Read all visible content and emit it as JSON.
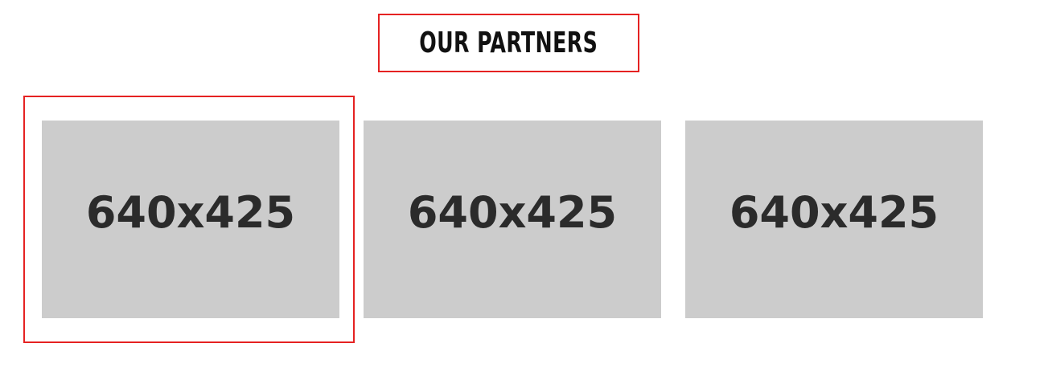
{
  "section": {
    "title": "OUR PARTNERS"
  },
  "partners": [
    {
      "placeholder_text": "640x425"
    },
    {
      "placeholder_text": "640x425"
    },
    {
      "placeholder_text": "640x425"
    }
  ],
  "colors": {
    "highlight": "#e52222",
    "placeholder_bg": "#cccccc",
    "placeholder_text": "#2b2b2b",
    "title_text": "#111111"
  }
}
